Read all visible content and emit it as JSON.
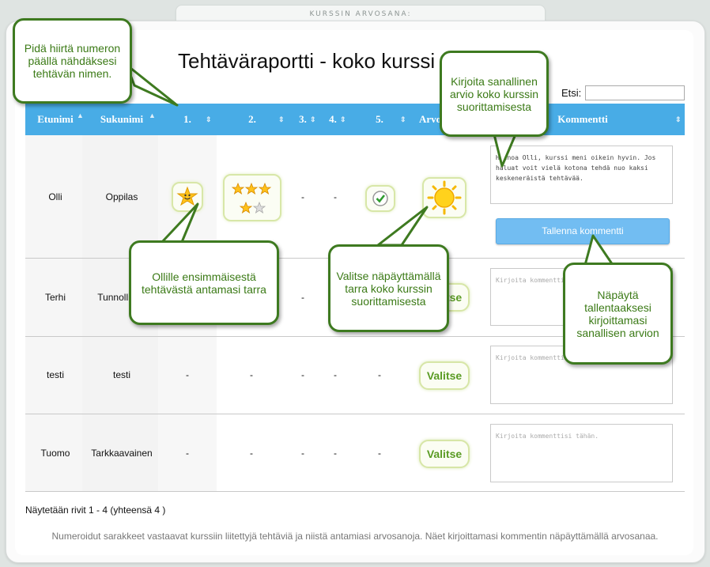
{
  "top_tab": {
    "label": "KURSSIN ARVOSANA:"
  },
  "page_title": "Tehtäväraportti - koko kurssi",
  "search": {
    "label": "Etsi:",
    "value": ""
  },
  "columns": {
    "first_name": "Etunimi",
    "last_name": "Sukunimi",
    "t1": "1.",
    "t2": "2.",
    "t3": "3.",
    "t4": "4.",
    "t5": "5.",
    "grade": "Arvosana",
    "comment": "Kommentti"
  },
  "rows": [
    {
      "first": "Olli",
      "last": "Oppilas",
      "t3": "-",
      "t4": "-",
      "comment": "Hienoa Olli, kurssi meni oikein hyvin. Jos haluat voit vielä kotona tehdä nuo kaksi keskeneräistä tehtävää."
    },
    {
      "first": "Terhi",
      "last": "Tunnollinen",
      "t3": "-",
      "grade": "Valitse",
      "comment_placeholder": "Kirjoita kommenttisi tähän."
    },
    {
      "first": "testi",
      "last": "testi",
      "t1": "-",
      "t2": "-",
      "t3": "-",
      "t4": "-",
      "t5": "-",
      "grade": "Valitse",
      "comment_placeholder": "Kirjoita kommenttisi tähän."
    },
    {
      "first": "Tuomo",
      "last": "Tarkkaavainen",
      "t1": "-",
      "t2": "-",
      "t3": "-",
      "t4": "-",
      "t5": "-",
      "grade": "Valitse",
      "comment_placeholder": "Kirjoita kommenttisi tähän."
    }
  ],
  "save_button": "Tallenna kommentti",
  "footer": {
    "showing": "Näytetään rivit 1 - 4 (yhteensä 4 )",
    "note": "Numeroidut sarakkeet vastaavat kurssiin liitettyjä tehtäviä ja niistä antamiasi arvosanoja. Näet kirjoittamasi kommentin näpäyttämällä arvosanaa."
  },
  "callouts": {
    "hover": "Pidä hiirtä numeron päällä nähdäksesi tehtävän nimen.",
    "comment": "Kirjoita sanallinen arvio koko kurssin suorittamisesta",
    "sticker": "Ollille ensimmäisestä tehtävästä antamasi tarra",
    "grade": "Valitse näpäyttämällä tarra koko kurssin suorittamisesta",
    "save": "Näpäytä tallentaaksesi kirjoittamasi sanallisen arvion"
  },
  "colors": {
    "header": "#48ace6",
    "callout_border": "#3e7a20",
    "button": "#72bdf2",
    "valitse": "#5a9b24"
  },
  "icons": {
    "t1": "smiley-star-icon",
    "t2": "three-stars-icon",
    "t5": "checkmark-icon",
    "grade": "sun-icon",
    "sort": "sort-arrows-icon"
  }
}
